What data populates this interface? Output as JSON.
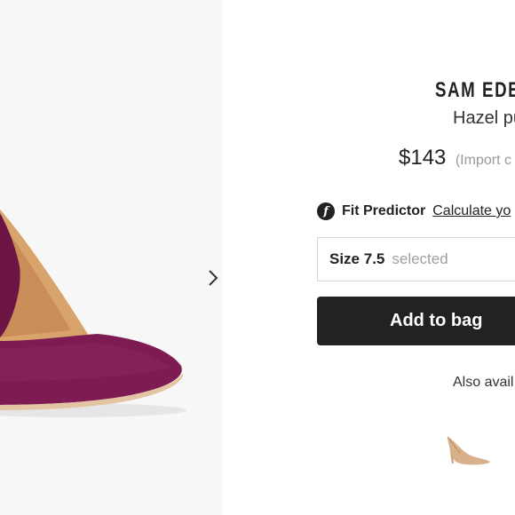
{
  "product": {
    "brand": "SAM EDE",
    "name": "Hazel pu",
    "price": "$143",
    "import_note": "(Import c",
    "image_color": "#7a1a4f",
    "thumb_color": "#d9b08c"
  },
  "fit_predictor": {
    "label": "Fit Predictor",
    "link": "Calculate yo",
    "icon": "f-logo-icon"
  },
  "size": {
    "value": "Size 7.5",
    "state": "selected"
  },
  "actions": {
    "add_to_bag": "Add to bag"
  },
  "also_available": {
    "label": "Also avail"
  },
  "gallery": {
    "next_icon": "chevron-right-icon"
  }
}
